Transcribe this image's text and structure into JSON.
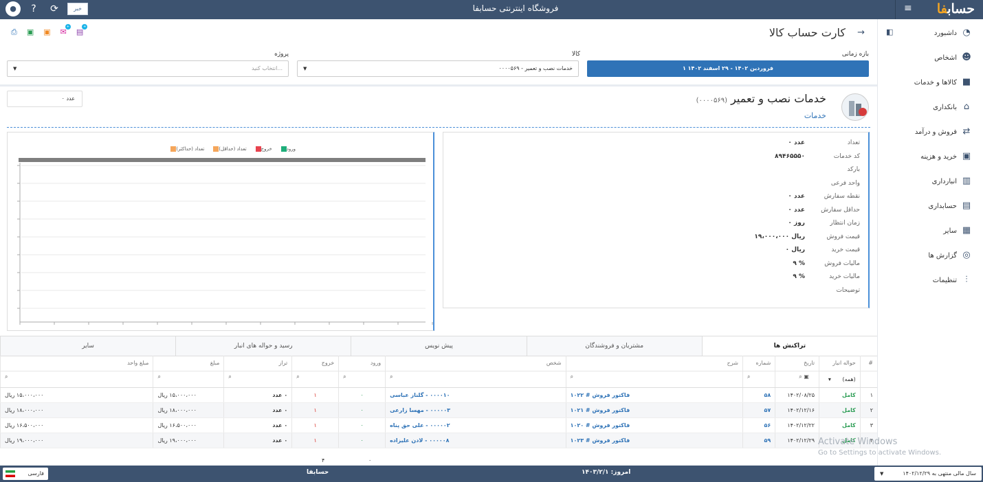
{
  "app": {
    "title": "فروشگاه اینترنتی حسابفا",
    "logo": "حساب",
    "logo_accent": "فا"
  },
  "topbar_icons": [
    {
      "name": "user-avatar-icon",
      "glyph": "●"
    },
    {
      "name": "help-icon",
      "glyph": "?"
    },
    {
      "name": "refresh-icon",
      "glyph": "⟳"
    },
    {
      "name": "news-icon",
      "glyph": "خبر"
    }
  ],
  "sidebar": {
    "items": [
      {
        "label": "داشبورد",
        "icon": "dashboard-icon",
        "glyph": "◔"
      },
      {
        "label": "اشخاص",
        "icon": "people-icon",
        "glyph": "☻"
      },
      {
        "label": "کالاها و خدمات",
        "icon": "box-icon",
        "glyph": "■"
      },
      {
        "label": "بانکداری",
        "icon": "bank-icon",
        "glyph": "⌂"
      },
      {
        "label": "فروش و درآمد",
        "icon": "sales-icon",
        "glyph": "⇄"
      },
      {
        "label": "خرید و هزینه",
        "icon": "purchase-icon",
        "glyph": "▣"
      },
      {
        "label": "انبارداری",
        "icon": "warehouse-icon",
        "glyph": "▥"
      },
      {
        "label": "حسابداری",
        "icon": "accounting-icon",
        "glyph": "▤"
      },
      {
        "label": "سایر",
        "icon": "other-icon",
        "glyph": "▦"
      },
      {
        "label": "گزارش ها",
        "icon": "reports-icon",
        "glyph": "◎"
      },
      {
        "label": "تنظیمات",
        "icon": "settings-icon",
        "glyph": "⫶"
      }
    ]
  },
  "page": {
    "title": "کارت حساب کالا"
  },
  "filters": {
    "period_label": "بازه زمانی",
    "period_value": "۱ فروردین ۱۴۰۲ - ۲۹ اسفند ۱۴۰۲",
    "item_label": "کالا",
    "item_value": "۰۰۰۰۵۶۹ - خدمات نصب و تعمیر",
    "project_label": "پروژه",
    "project_placeholder": "انتخاب کنید..."
  },
  "product": {
    "name": "خدمات نصب و تعمیر",
    "code": "(۰۰۰۰۵۶۹)",
    "category": "خدمات",
    "count": "۰ عدد"
  },
  "details": [
    {
      "k": "تعداد",
      "v": "۰ عدد"
    },
    {
      "k": "کد خدمات",
      "v": "۸۹۴۶۵۵۵۰"
    },
    {
      "k": "بارکد",
      "v": ""
    },
    {
      "k": "واحد فرعی",
      "v": ""
    },
    {
      "k": "نقطه سفارش",
      "v": "۰ عدد"
    },
    {
      "k": "حداقل سفارش",
      "v": "۰ عدد"
    },
    {
      "k": "زمان انتظار",
      "v": "۰ روز"
    },
    {
      "k": "قیمت فروش",
      "v": "۱۹،۰۰۰،۰۰۰ ریال"
    },
    {
      "k": "قیمت خرید",
      "v": "۰ ریال"
    },
    {
      "k": "مالیات فروش",
      "v": "۹ %"
    },
    {
      "k": "مالیات خرید",
      "v": "۹ %"
    },
    {
      "k": "توضیحات",
      "v": ""
    }
  ],
  "legend": [
    {
      "label": "تعداد (حداکثر)",
      "color": "#f5a65b"
    },
    {
      "label": "تعداد (حداقل)",
      "color": "#f5a65b"
    },
    {
      "label": "خروج",
      "color": "#e8434f"
    },
    {
      "label": "ورود",
      "color": "#1fae7a"
    }
  ],
  "tabs": [
    "تراکنش ها",
    "مشتریان و فروشندگان",
    "پیش نویس",
    "رسید و حواله های انبار",
    "سایر"
  ],
  "table": {
    "headers": [
      "#",
      "حواله انبار",
      "تاریخ",
      "شماره",
      "شرح",
      "شخص",
      "ورود",
      "خروج",
      "تراز",
      "مبلغ",
      "مبلغ واحد"
    ],
    "filter_all": "(همه)",
    "rows": [
      [
        "۱",
        "کامل",
        "۱۴۰۲/۰۸/۲۵",
        "۵۸",
        "فاکتور فروش # ۱۰۲۲",
        "۰۰۰۰۱۰ - گلناز عباسی",
        "۰",
        "۱",
        "۰ عدد",
        "۱۵،۰۰۰،۰۰۰ ریال",
        "۱۵،۰۰۰،۰۰۰ ریال"
      ],
      [
        "۲",
        "کامل",
        "۱۴۰۲/۱۲/۱۶",
        "۵۷",
        "فاکتور فروش # ۱۰۲۱",
        "۰۰۰۰۰۳ - مهسا زارعی",
        "۰",
        "۱",
        "۰ عدد",
        "۱۸،۰۰۰،۰۰۰ ریال",
        "۱۸،۰۰۰،۰۰۰ ریال"
      ],
      [
        "۳",
        "کامل",
        "۱۴۰۲/۱۲/۲۲",
        "۵۶",
        "فاکتور فروش # ۱۰۲۰",
        "۰۰۰۰۰۲ - علی حق پناه",
        "۰",
        "۱",
        "۰ عدد",
        "۱۶،۵۰۰،۰۰۰ ریال",
        "۱۶،۵۰۰،۰۰۰ ریال"
      ],
      [
        "۴",
        "کامل",
        "۱۴۰۲/۱۲/۲۹",
        "۵۹",
        "فاکتور فروش # ۱۰۲۳",
        "۰۰۰۰۰۸ - لادن علیزاده",
        "۰",
        "۱",
        "۰ عدد",
        "۱۹،۰۰۰،۰۰۰ ریال",
        "۱۹،۰۰۰،۰۰۰ ریال"
      ]
    ],
    "totals": {
      "in": "۰",
      "out": "۴"
    }
  },
  "footer": {
    "year": "سال مالی منتهی به ۱۴۰۲/۱۲/۲۹",
    "today": "امروز: ۱۴۰۳/۲/۱",
    "brand": "حسابفا",
    "lang": "فارسی"
  },
  "watermark": {
    "line1": "Activate Windows",
    "line2": "Go to Settings to activate Windows."
  }
}
